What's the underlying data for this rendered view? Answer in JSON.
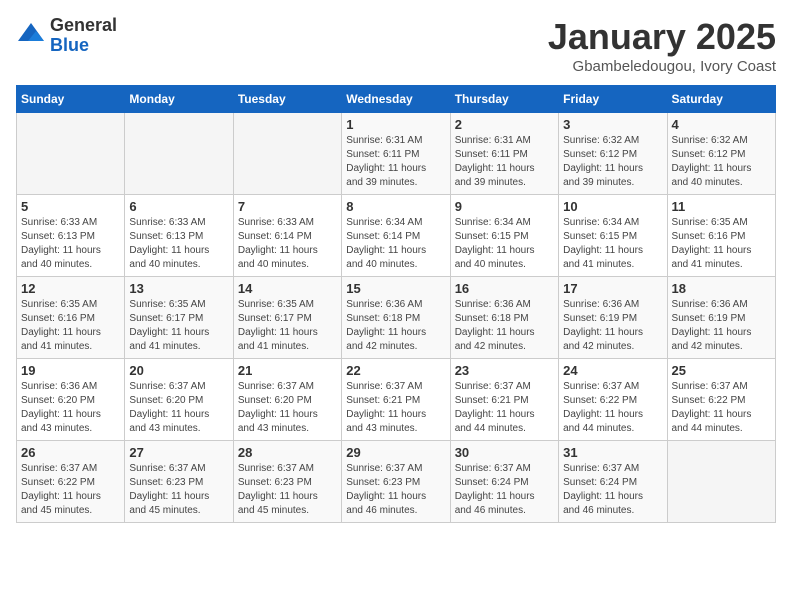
{
  "logo": {
    "general": "General",
    "blue": "Blue"
  },
  "title": "January 2025",
  "location": "Gbambeledougou, Ivory Coast",
  "weekdays": [
    "Sunday",
    "Monday",
    "Tuesday",
    "Wednesday",
    "Thursday",
    "Friday",
    "Saturday"
  ],
  "weeks": [
    [
      {
        "day": "",
        "info": ""
      },
      {
        "day": "",
        "info": ""
      },
      {
        "day": "",
        "info": ""
      },
      {
        "day": "1",
        "info": "Sunrise: 6:31 AM\nSunset: 6:11 PM\nDaylight: 11 hours\nand 39 minutes."
      },
      {
        "day": "2",
        "info": "Sunrise: 6:31 AM\nSunset: 6:11 PM\nDaylight: 11 hours\nand 39 minutes."
      },
      {
        "day": "3",
        "info": "Sunrise: 6:32 AM\nSunset: 6:12 PM\nDaylight: 11 hours\nand 39 minutes."
      },
      {
        "day": "4",
        "info": "Sunrise: 6:32 AM\nSunset: 6:12 PM\nDaylight: 11 hours\nand 40 minutes."
      }
    ],
    [
      {
        "day": "5",
        "info": "Sunrise: 6:33 AM\nSunset: 6:13 PM\nDaylight: 11 hours\nand 40 minutes."
      },
      {
        "day": "6",
        "info": "Sunrise: 6:33 AM\nSunset: 6:13 PM\nDaylight: 11 hours\nand 40 minutes."
      },
      {
        "day": "7",
        "info": "Sunrise: 6:33 AM\nSunset: 6:14 PM\nDaylight: 11 hours\nand 40 minutes."
      },
      {
        "day": "8",
        "info": "Sunrise: 6:34 AM\nSunset: 6:14 PM\nDaylight: 11 hours\nand 40 minutes."
      },
      {
        "day": "9",
        "info": "Sunrise: 6:34 AM\nSunset: 6:15 PM\nDaylight: 11 hours\nand 40 minutes."
      },
      {
        "day": "10",
        "info": "Sunrise: 6:34 AM\nSunset: 6:15 PM\nDaylight: 11 hours\nand 41 minutes."
      },
      {
        "day": "11",
        "info": "Sunrise: 6:35 AM\nSunset: 6:16 PM\nDaylight: 11 hours\nand 41 minutes."
      }
    ],
    [
      {
        "day": "12",
        "info": "Sunrise: 6:35 AM\nSunset: 6:16 PM\nDaylight: 11 hours\nand 41 minutes."
      },
      {
        "day": "13",
        "info": "Sunrise: 6:35 AM\nSunset: 6:17 PM\nDaylight: 11 hours\nand 41 minutes."
      },
      {
        "day": "14",
        "info": "Sunrise: 6:35 AM\nSunset: 6:17 PM\nDaylight: 11 hours\nand 41 minutes."
      },
      {
        "day": "15",
        "info": "Sunrise: 6:36 AM\nSunset: 6:18 PM\nDaylight: 11 hours\nand 42 minutes."
      },
      {
        "day": "16",
        "info": "Sunrise: 6:36 AM\nSunset: 6:18 PM\nDaylight: 11 hours\nand 42 minutes."
      },
      {
        "day": "17",
        "info": "Sunrise: 6:36 AM\nSunset: 6:19 PM\nDaylight: 11 hours\nand 42 minutes."
      },
      {
        "day": "18",
        "info": "Sunrise: 6:36 AM\nSunset: 6:19 PM\nDaylight: 11 hours\nand 42 minutes."
      }
    ],
    [
      {
        "day": "19",
        "info": "Sunrise: 6:36 AM\nSunset: 6:20 PM\nDaylight: 11 hours\nand 43 minutes."
      },
      {
        "day": "20",
        "info": "Sunrise: 6:37 AM\nSunset: 6:20 PM\nDaylight: 11 hours\nand 43 minutes."
      },
      {
        "day": "21",
        "info": "Sunrise: 6:37 AM\nSunset: 6:20 PM\nDaylight: 11 hours\nand 43 minutes."
      },
      {
        "day": "22",
        "info": "Sunrise: 6:37 AM\nSunset: 6:21 PM\nDaylight: 11 hours\nand 43 minutes."
      },
      {
        "day": "23",
        "info": "Sunrise: 6:37 AM\nSunset: 6:21 PM\nDaylight: 11 hours\nand 44 minutes."
      },
      {
        "day": "24",
        "info": "Sunrise: 6:37 AM\nSunset: 6:22 PM\nDaylight: 11 hours\nand 44 minutes."
      },
      {
        "day": "25",
        "info": "Sunrise: 6:37 AM\nSunset: 6:22 PM\nDaylight: 11 hours\nand 44 minutes."
      }
    ],
    [
      {
        "day": "26",
        "info": "Sunrise: 6:37 AM\nSunset: 6:22 PM\nDaylight: 11 hours\nand 45 minutes."
      },
      {
        "day": "27",
        "info": "Sunrise: 6:37 AM\nSunset: 6:23 PM\nDaylight: 11 hours\nand 45 minutes."
      },
      {
        "day": "28",
        "info": "Sunrise: 6:37 AM\nSunset: 6:23 PM\nDaylight: 11 hours\nand 45 minutes."
      },
      {
        "day": "29",
        "info": "Sunrise: 6:37 AM\nSunset: 6:23 PM\nDaylight: 11 hours\nand 46 minutes."
      },
      {
        "day": "30",
        "info": "Sunrise: 6:37 AM\nSunset: 6:24 PM\nDaylight: 11 hours\nand 46 minutes."
      },
      {
        "day": "31",
        "info": "Sunrise: 6:37 AM\nSunset: 6:24 PM\nDaylight: 11 hours\nand 46 minutes."
      },
      {
        "day": "",
        "info": ""
      }
    ]
  ]
}
